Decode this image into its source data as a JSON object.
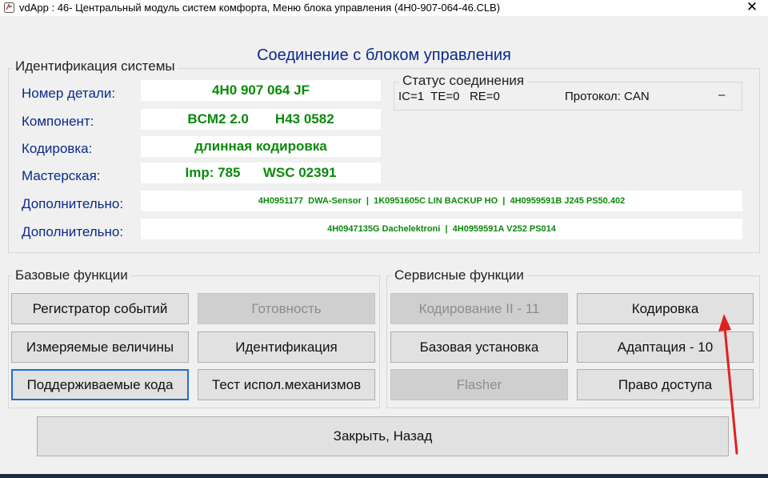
{
  "window": {
    "title": "vdApp : 46- Центральный модуль систем комфорта,  Меню блока управления (4H0-907-064-46.CLB)",
    "close_symbol": "✕",
    "heading": "Соединение с блоком управления"
  },
  "identification": {
    "title": "Идентификация системы",
    "fields": [
      {
        "label": "Номер детали:",
        "value": "4H0 907 064 JF"
      },
      {
        "label": "Компонент:",
        "value": "BCM2 2.0       H43 0582"
      },
      {
        "label": "Кодировка:",
        "value": "длинная кодировка"
      },
      {
        "label": "Мастерская:",
        "value": "Imp: 785      WSC 02391"
      },
      {
        "label": "Дополнительно:",
        "value": "4H0951177  DWA-Sensor  |  1K0951605C LIN BACKUP HO  |  4H0959591B J245 PS50.402"
      },
      {
        "label": "Дополнительно:",
        "value": "4H0947135G Dachelektroni  |  4H0959591A V252 PS014"
      }
    ]
  },
  "connection_status": {
    "title": "Статус соединения",
    "counters": "IC=1  TE=0   RE=0",
    "protocol": "Протокол: CAN",
    "dash": "–"
  },
  "basic_functions": {
    "title": "Базовые функции",
    "buttons": [
      "Регистратор событий",
      "Готовность",
      "Измеряемые величины",
      "Идентификация",
      "Поддерживаемые кода",
      "Тест испол.механизмов"
    ]
  },
  "service_functions": {
    "title": "Сервисные функции",
    "buttons": [
      "Кодирование II - 11",
      "Кодировка",
      "Базовая установка",
      "Адаптация - 10",
      "Flasher",
      "Право доступа"
    ]
  },
  "close_button": "Закрыть, Назад",
  "colors": {
    "heading_blue": "#0b2a8a",
    "value_green": "#0a8a0a",
    "annotation_red": "#e02020"
  }
}
